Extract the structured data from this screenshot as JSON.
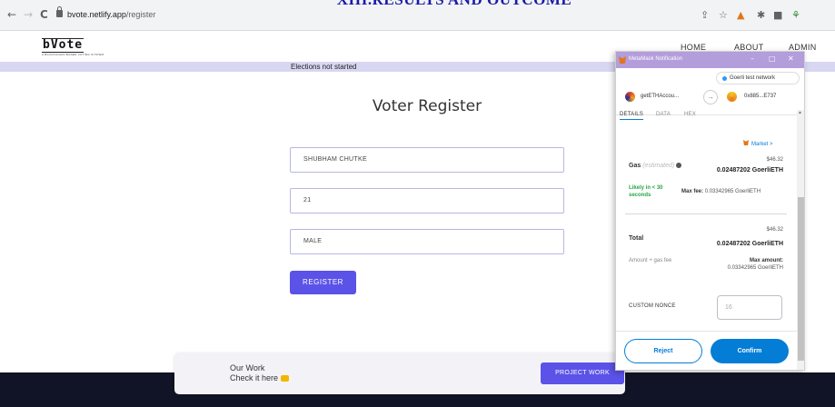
{
  "doc_heading": "XIII.RESULTS AND OUTCOME",
  "browser": {
    "url_host": "bvote.netlify.app",
    "url_path": "/register",
    "back": "←",
    "forward": "→",
    "reload": "C"
  },
  "site": {
    "logo": "bVote",
    "logo_sub": "A BLOCKCHAIN BASED VOTING SYSTEM",
    "nav": [
      "HOME",
      "ABOUT",
      "ADMIN"
    ],
    "status": "Elections not started",
    "page_title": "Voter Register",
    "fields": {
      "name": "SHUBHAM CHUTKE",
      "age": "21",
      "gender": "MALE"
    },
    "register_label": "REGISTER",
    "footer": {
      "line1": "Our Work",
      "line2": "Check it here",
      "button": "PROJECT WORK"
    }
  },
  "metamask": {
    "title": "MetaMask Notification",
    "network": "Goerli test network",
    "from_account": "getETHAccou...",
    "to_account": "0x885...E737",
    "tabs": [
      "DETAILS",
      "DATA",
      "HEX"
    ],
    "market": "Market >",
    "gas": {
      "label": "Gas",
      "estimated": "(estimated)",
      "usd": "$46.32",
      "eth": "0.02487202 GoerliETH",
      "likely": "Likely in < 30 seconds",
      "max_fee_label": "Max fee:",
      "max_fee": "0.03342965 GoerliETH"
    },
    "total": {
      "label": "Total",
      "usd": "$46.32",
      "eth": "0.02487202 GoerliETH",
      "amount_gas": "Amount + gas fee",
      "max_amount_label": "Max amount:",
      "max_amount": "0.03342965 GoerliETH"
    },
    "nonce_label": "CUSTOM NONCE",
    "nonce_value": "16",
    "reject": "Reject",
    "confirm": "Confirm"
  },
  "colors": {
    "accent": "#5b52e8",
    "metamask_blue": "#037dd6",
    "status_bar": "#d7d7f3",
    "footer_dark": "#111426"
  }
}
